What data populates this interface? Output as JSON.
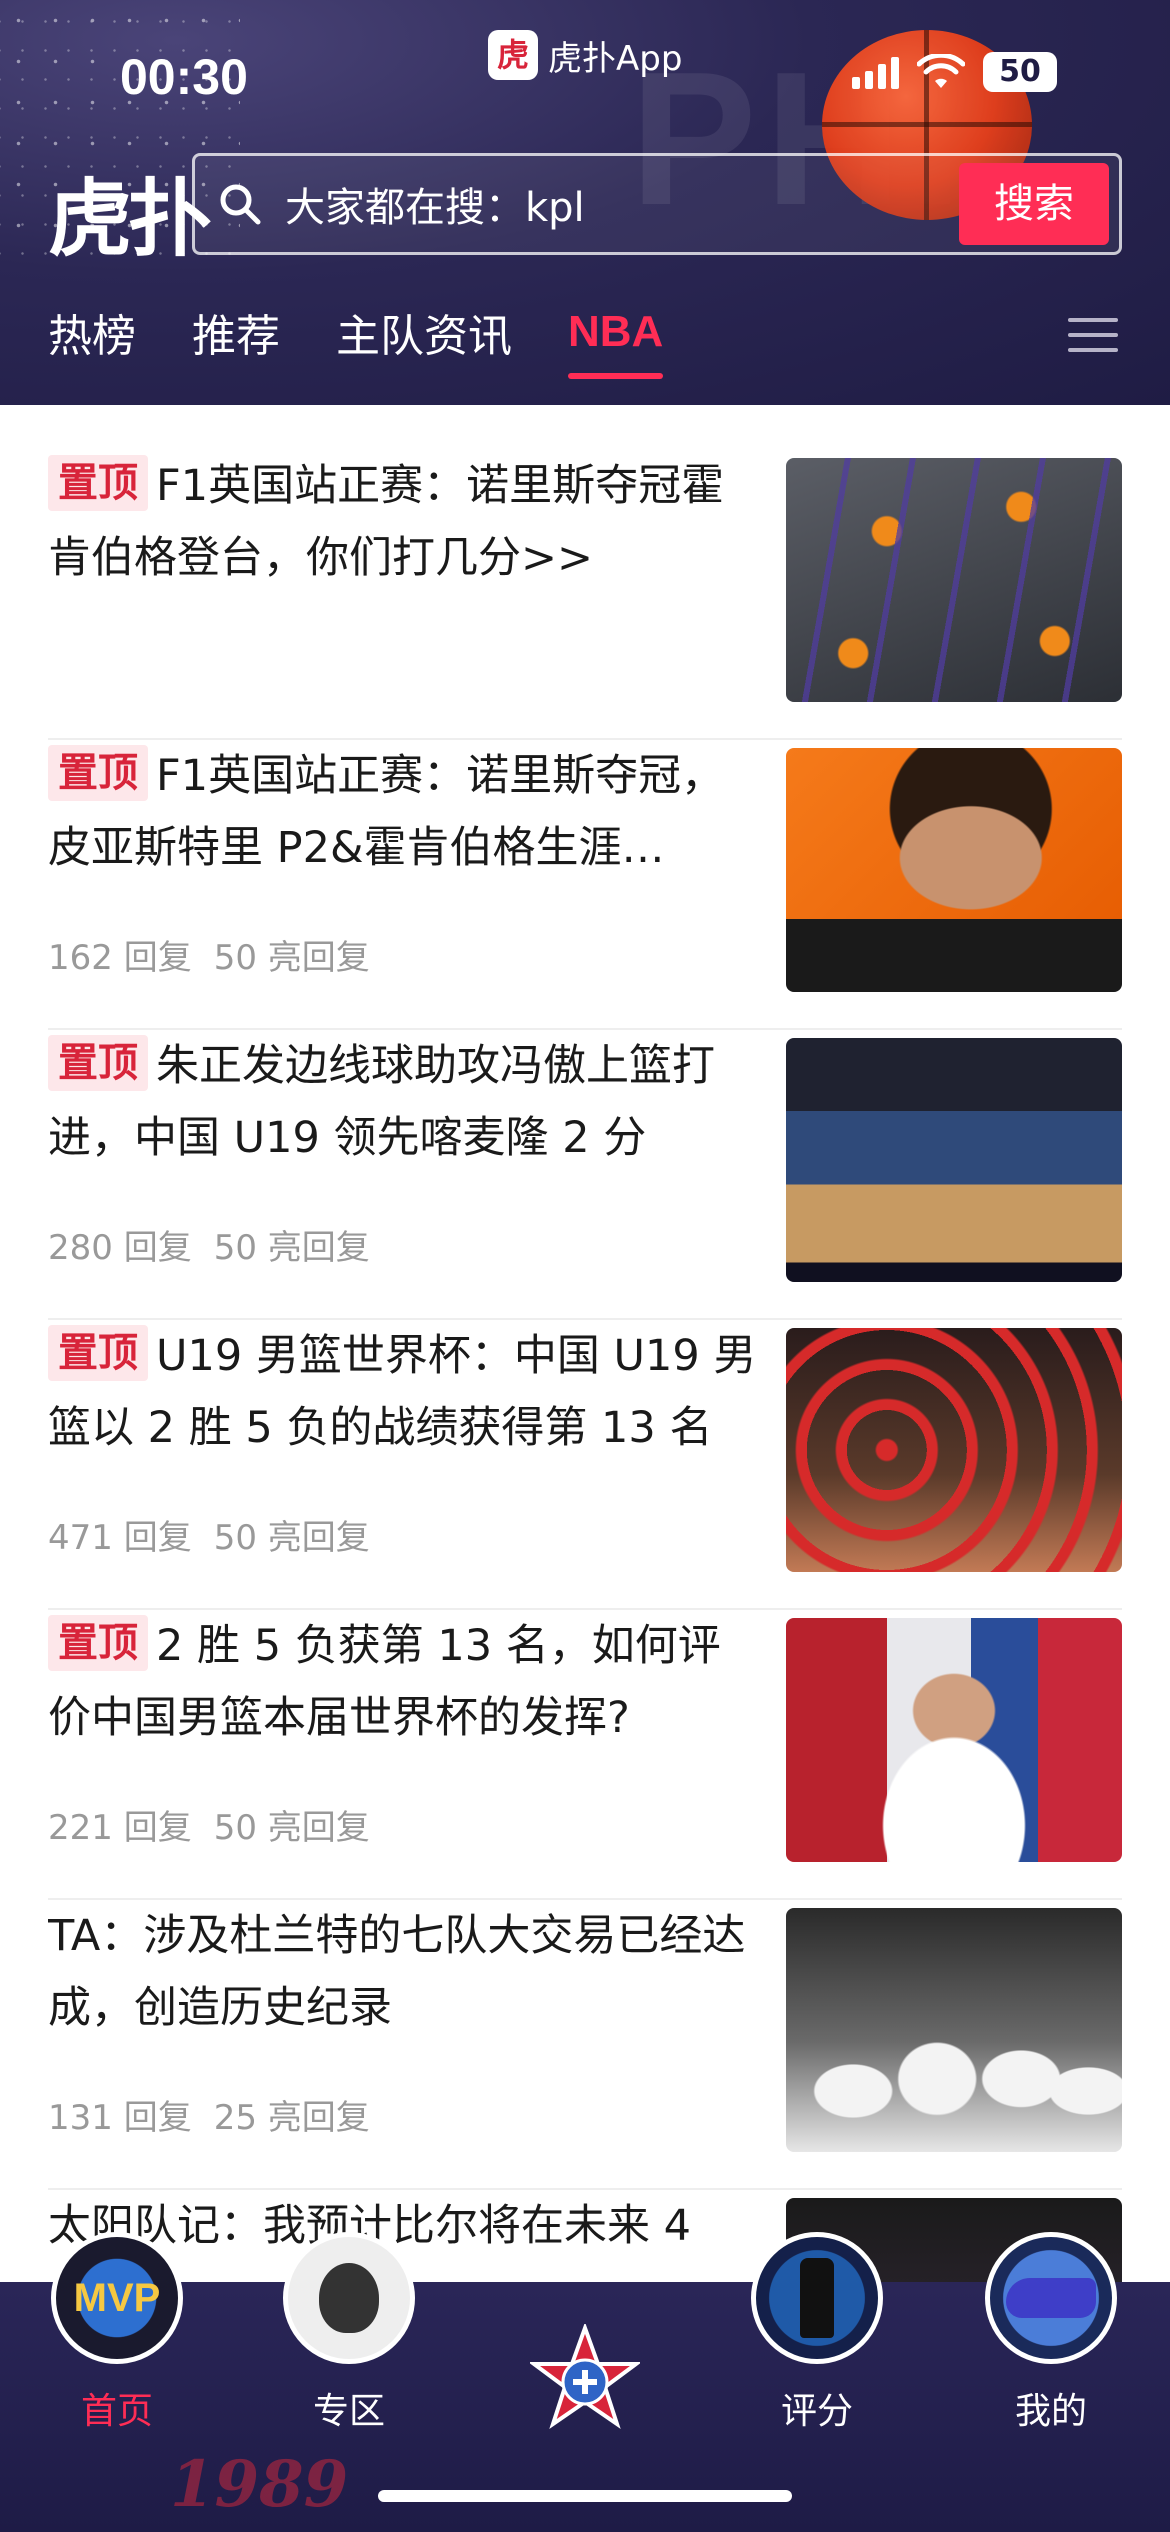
{
  "status_bar": {
    "time": "00:30",
    "app_return_label": "虎扑App",
    "app_icon_char": "虎",
    "battery": "50"
  },
  "header": {
    "logo": "虎扑",
    "search": {
      "placeholder": "大家都在搜：kpl",
      "button_label": "搜索"
    },
    "tabs": [
      {
        "label": "热榜",
        "active": false
      },
      {
        "label": "推荐",
        "active": false
      },
      {
        "label": "主队资讯",
        "active": false
      },
      {
        "label": "NBA",
        "active": true
      }
    ],
    "accent_color": "#ff2d55"
  },
  "feed": {
    "pin_label": "置顶",
    "items": [
      {
        "pinned": true,
        "title": "F1英国站正赛：诺里斯夺冠霍肯伯格登台，你们打几分>>",
        "replies": "",
        "light_replies": "",
        "thumb": "f1-pit-stop"
      },
      {
        "pinned": true,
        "title": "F1英国站正赛：诺里斯夺冠，皮亚斯特里 P2&霍肯伯格生涯…",
        "replies": "162 回复",
        "light_replies": "50 亮回复",
        "thumb": "driver-portrait"
      },
      {
        "pinned": true,
        "title": "朱正发边线球助攻冯傲上篮打进，中国 U19 领先喀麦隆 2 分",
        "replies": "280 回复",
        "light_replies": "50 亮回复",
        "thumb": "basketball-game"
      },
      {
        "pinned": true,
        "title": "U19 男篮世界杯：中国 U19 男篮以 2 胜 5 负的战绩获得第 13 名",
        "replies": "471 回复",
        "light_replies": "50 亮回复",
        "thumb": "team-photo"
      },
      {
        "pinned": true,
        "title": "2 胜 5 负获第 13 名，如何评价中国男篮本届世界杯的发挥?",
        "replies": "221 回复",
        "light_replies": "50 亮回复",
        "thumb": "china-player"
      },
      {
        "pinned": false,
        "title": "TA：涉及杜兰特的七队大交易已经达成，创造历史纪录",
        "replies": "131 回复",
        "light_replies": "25 亮回复",
        "thumb": "rockets-players"
      },
      {
        "pinned": false,
        "title": "太阳队记：我预计比尔将在未来 4",
        "replies": "",
        "light_replies": "",
        "thumb": "suns"
      }
    ]
  },
  "tabbar": {
    "items": [
      {
        "label": "首页",
        "active": true,
        "icon": "mvp-avatar-icon",
        "avatar_text": "MVP"
      },
      {
        "label": "专区",
        "active": false,
        "icon": "zone-avatar-icon"
      },
      {
        "label": "",
        "active": false,
        "icon": "star-publish-icon"
      },
      {
        "label": "评分",
        "active": false,
        "icon": "rating-bottle-icon"
      },
      {
        "label": "我的",
        "active": false,
        "icon": "sneaker-avatar-icon"
      }
    ],
    "watermark": "1989"
  }
}
